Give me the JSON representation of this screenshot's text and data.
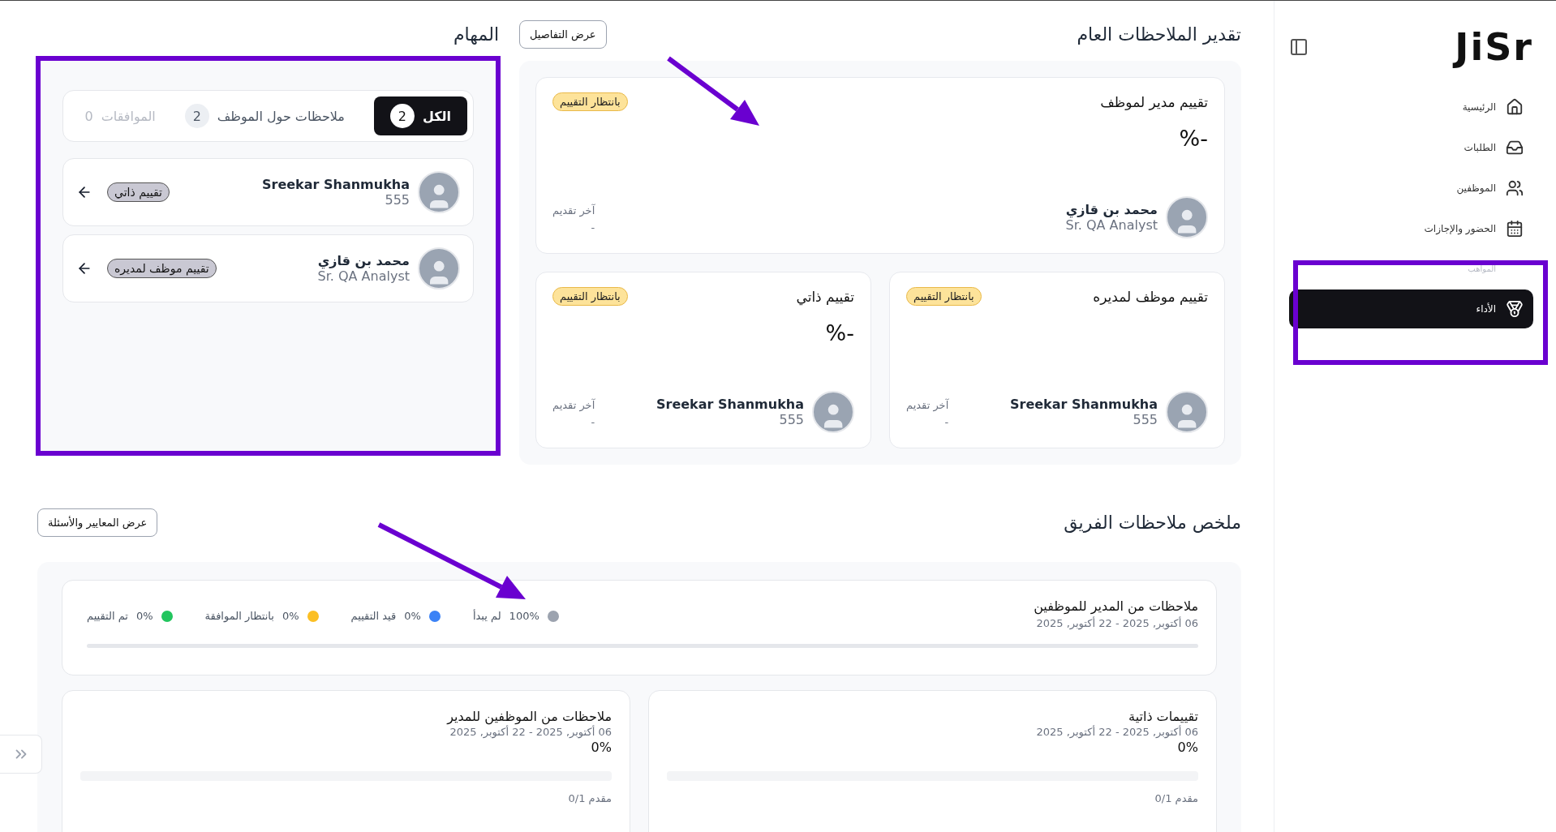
{
  "sidebar": {
    "logo": "JiSr",
    "items": [
      {
        "label": "الرئيسية",
        "selected": false,
        "faded": false
      },
      {
        "label": "الطلبات",
        "selected": false,
        "faded": false
      },
      {
        "label": "الموظفين",
        "selected": false,
        "faded": false
      },
      {
        "label": "الحضور والإجازات",
        "selected": false,
        "faded": false
      },
      {
        "label": "المواهب",
        "selected": false,
        "faded": true
      },
      {
        "label": "الأداء",
        "selected": true,
        "faded": false
      }
    ]
  },
  "overview": {
    "title": "تقدير الملاحظات العام",
    "button": "عرض التفاصيل",
    "cards": [
      {
        "title": "تقييم مدير لموظف",
        "status": "بانتظار التقييم",
        "percent": "-%",
        "name": "محمد بن قازي",
        "subtitle": "Sr. QA Analyst",
        "last_label": "آخر تقديم",
        "last_value": "-",
        "wide": true
      },
      {
        "title": "تقييم موظف لمديره",
        "status": "بانتظار التقييم",
        "name": "Sreekar Shanmukha",
        "subtitle": "555",
        "last_label": "آخر تقديم",
        "last_value": "-",
        "wide": false
      },
      {
        "title": "تقييم ذاتي",
        "status": "بانتظار التقييم",
        "percent": "-%",
        "name": "Sreekar Shanmukha",
        "subtitle": "555",
        "last_label": "آخر تقديم",
        "last_value": "-",
        "wide": false
      }
    ]
  },
  "tasks": {
    "title": "المهام",
    "tabs": [
      {
        "label": "الكل",
        "count": "2",
        "selected": true,
        "disabled": false
      },
      {
        "label": "ملاحظات حول الموظف",
        "count": "2",
        "selected": false,
        "disabled": false
      },
      {
        "label": "الموافقات",
        "count": "0",
        "selected": false,
        "disabled": true
      }
    ],
    "items": [
      {
        "name": "Sreekar Shanmukha",
        "subtitle": "555",
        "tag": "تقييم ذاتي"
      },
      {
        "name": "محمد بن قازي",
        "subtitle": "Sr. QA Analyst",
        "tag": "تقييم موظف لمديره"
      }
    ]
  },
  "team": {
    "title": "ملخص ملاحظات الفريق",
    "button": "عرض المعايير والأسئلة",
    "summary": {
      "title": "ملاحظات من المدير للموظفين",
      "dates": "06 أكتوبر, 2025 - 22 أكتوبر, 2025",
      "legend": [
        {
          "label": "لم يبدأ",
          "value": "100%",
          "color": "#9ca3af"
        },
        {
          "label": "قيد التقييم",
          "value": "0%",
          "color": "#3b82f6"
        },
        {
          "label": "بانتظار الموافقة",
          "value": "0%",
          "color": "#fbbf24"
        },
        {
          "label": "تم التقييم",
          "value": "0%",
          "color": "#22c55e"
        }
      ]
    },
    "cards": [
      {
        "title": "تقييمات ذاتية",
        "dates": "06 أكتوبر, 2025 - 22 أكتوبر, 2025",
        "percent": "0%",
        "level": 0,
        "count": "مقدم 0/1"
      },
      {
        "title": "ملاحظات من الموظفين للمدير",
        "dates": "06 أكتوبر, 2025 - 22 أكتوبر, 2025",
        "percent": "0%",
        "level": 0,
        "count": "مقدم 0/1"
      }
    ]
  }
}
